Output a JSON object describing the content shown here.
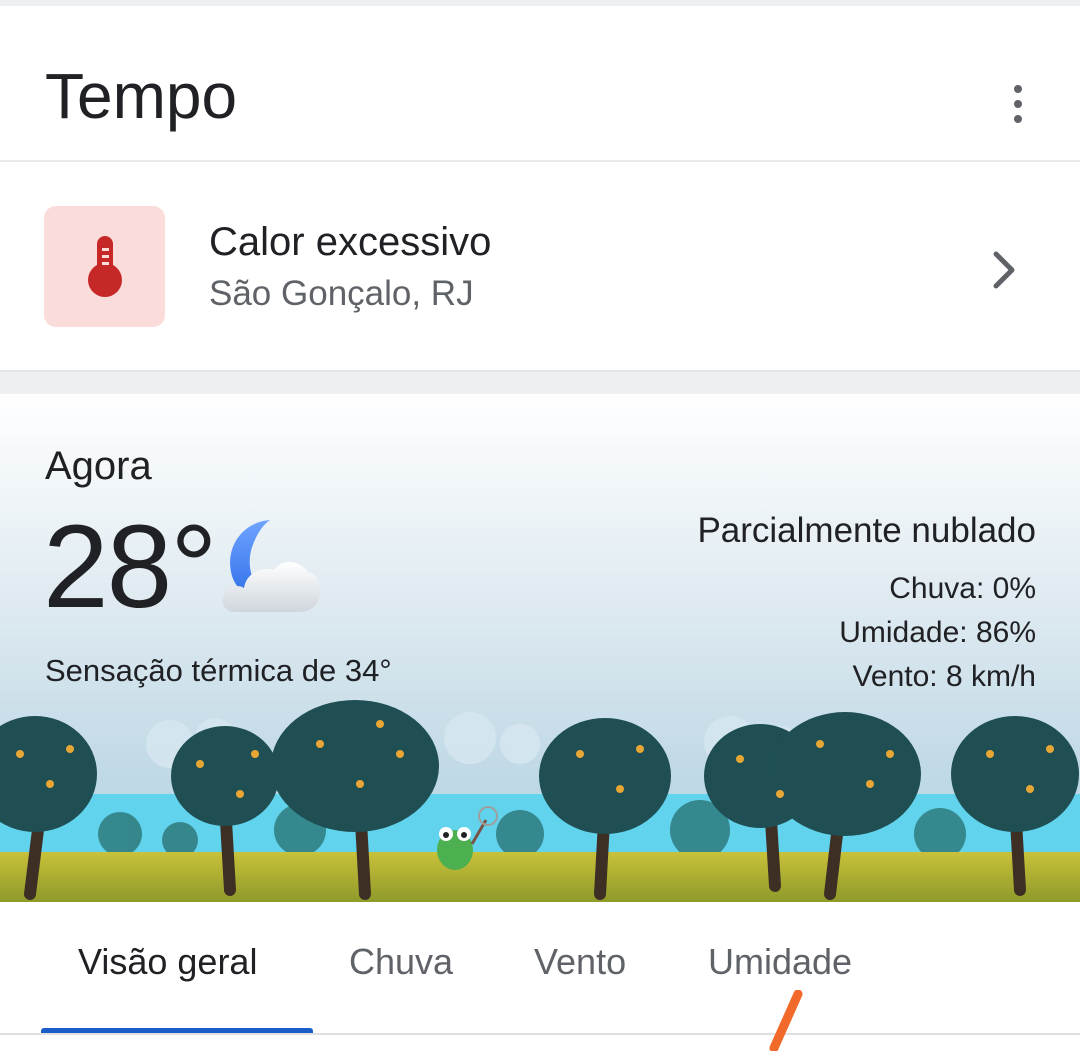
{
  "app": {
    "title": "Tempo"
  },
  "alert": {
    "title": "Calor excessivo",
    "location": "São Gonçalo, RJ",
    "icon": "thermometer-icon",
    "accent": "#c62828",
    "tile_color": "#fadcda"
  },
  "current": {
    "label": "Agora",
    "temperature": "28°",
    "condition_icon": "partly-cloudy-night-icon",
    "feels_like": "Sensação térmica de 34°",
    "condition": "Parcialmente nublado",
    "rain": "Chuva: 0%",
    "humidity": "Umidade: 86%",
    "wind": "Vento: 8 km/h"
  },
  "tabs": [
    {
      "label": "Visão geral",
      "active": true
    },
    {
      "label": "Chuva",
      "active": false
    },
    {
      "label": "Vento",
      "active": false
    },
    {
      "label": "Umidade",
      "active": false
    }
  ],
  "colors": {
    "tab_indicator": "#1a5dc8",
    "text_primary": "#202124",
    "text_secondary": "#5f6368"
  }
}
